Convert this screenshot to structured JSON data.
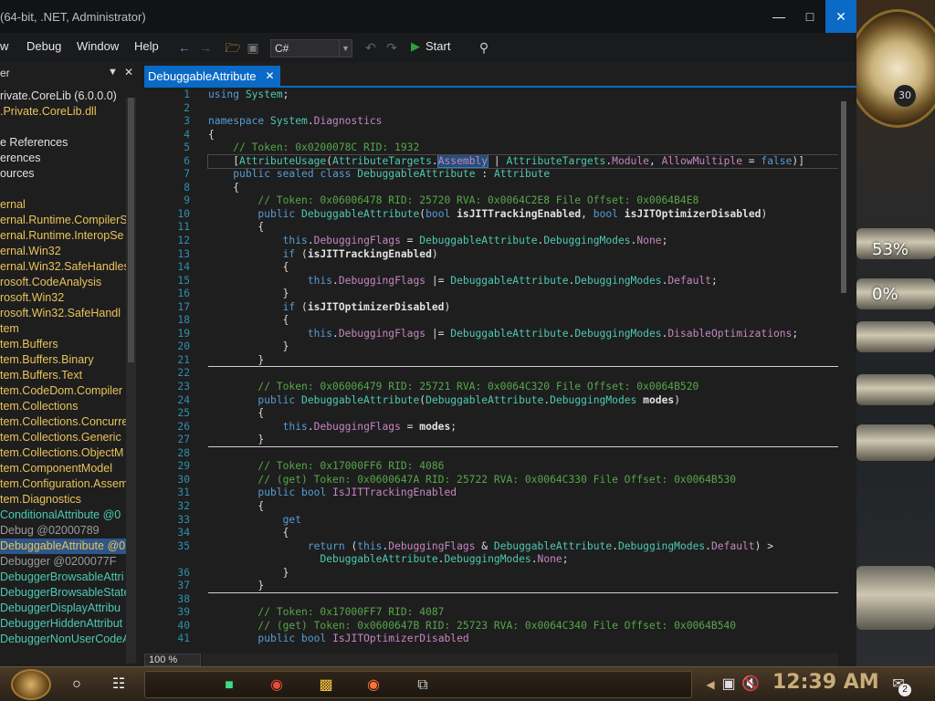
{
  "window": {
    "title": "(64-bit, .NET, Administrator)",
    "minimize_icon": "minimize-icon",
    "maximize_icon": "maximize-icon",
    "close_icon": "close-icon"
  },
  "menu": [
    "w",
    "Debug",
    "Window",
    "Help"
  ],
  "toolbar": {
    "language": "C#",
    "start_label": "Start"
  },
  "tree": {
    "header": "er",
    "items": [
      {
        "text": "rivate.CoreLib (6.0.0.0)",
        "style": "w"
      },
      {
        "text": ".Private.CoreLib.dll",
        "style": "p"
      },
      {
        "text": "",
        "style": "w"
      },
      {
        "text": "e References",
        "style": "w"
      },
      {
        "text": "erences",
        "style": "w"
      },
      {
        "text": "ources",
        "style": "w"
      },
      {
        "text": "",
        "style": "w"
      },
      {
        "text": "ernal",
        "style": "p"
      },
      {
        "text": "ernal.Runtime.CompilerSe",
        "style": "p"
      },
      {
        "text": "ernal.Runtime.InteropSe",
        "style": "p"
      },
      {
        "text": "ernal.Win32",
        "style": "p"
      },
      {
        "text": "ernal.Win32.SafeHandles",
        "style": "p"
      },
      {
        "text": "rosoft.CodeAnalysis",
        "style": "p"
      },
      {
        "text": "rosoft.Win32",
        "style": "p"
      },
      {
        "text": "rosoft.Win32.SafeHandl",
        "style": "p"
      },
      {
        "text": "tem",
        "style": "p"
      },
      {
        "text": "tem.Buffers",
        "style": "p"
      },
      {
        "text": "tem.Buffers.Binary",
        "style": "p"
      },
      {
        "text": "tem.Buffers.Text",
        "style": "p"
      },
      {
        "text": "tem.CodeDom.Compiler",
        "style": "p"
      },
      {
        "text": "tem.Collections",
        "style": "p"
      },
      {
        "text": "tem.Collections.Concurre",
        "style": "p"
      },
      {
        "text": "tem.Collections.Generic",
        "style": "p"
      },
      {
        "text": "tem.Collections.ObjectM",
        "style": "p"
      },
      {
        "text": "tem.ComponentModel",
        "style": "p"
      },
      {
        "text": "tem.Configuration.Assem",
        "style": "p"
      },
      {
        "text": "tem.Diagnostics",
        "style": "p"
      },
      {
        "text": "ConditionalAttribute @0",
        "style": "c"
      },
      {
        "text": "Debug  @02000789",
        "style": "d"
      },
      {
        "text": "DebuggableAttribute @0",
        "style": "sel"
      },
      {
        "text": "Debugger  @0200077F",
        "style": "d"
      },
      {
        "text": "DebuggerBrowsableAttri",
        "style": "c"
      },
      {
        "text": "DebuggerBrowsableState",
        "style": "c"
      },
      {
        "text": "DebuggerDisplayAttribu",
        "style": "c"
      },
      {
        "text": "DebuggerHiddenAttribut",
        "style": "c"
      },
      {
        "text": "DebuggerNonUserCodeA",
        "style": "c"
      }
    ]
  },
  "tab": {
    "label": "DebuggableAttribute",
    "close_icon": "close-icon"
  },
  "zoom": "100 %",
  "line_numbers": [
    "1",
    "2",
    "3",
    "4",
    "5",
    "6",
    "7",
    "8",
    "9",
    "10",
    "11",
    "12",
    "13",
    "14",
    "15",
    "16",
    "17",
    "18",
    "19",
    "20",
    "21",
    "22",
    "23",
    "24",
    "25",
    "26",
    "27",
    "28",
    "29",
    "30",
    "31",
    "32",
    "33",
    "34",
    "35",
    "",
    "36",
    "37",
    "38",
    "39",
    "40",
    "41"
  ],
  "code": [
    "using System;",
    "",
    "namespace System.Diagnostics",
    "{",
    "    // Token: 0x0200078C RID: 1932",
    "    [AttributeUsage(AttributeTargets.Assembly | AttributeTargets.Module, AllowMultiple = false)]",
    "    public sealed class DebuggableAttribute : Attribute",
    "    {",
    "        // Token: 0x06006478 RID: 25720 RVA: 0x0064C2E8 File Offset: 0x0064B4E8",
    "        public DebuggableAttribute(bool isJITTrackingEnabled, bool isJITOptimizerDisabled)",
    "        {",
    "            this.DebuggingFlags = DebuggableAttribute.DebuggingModes.None;",
    "            if (isJITTrackingEnabled)",
    "            {",
    "                this.DebuggingFlags |= DebuggableAttribute.DebuggingModes.Default;",
    "            }",
    "            if (isJITOptimizerDisabled)",
    "            {",
    "                this.DebuggingFlags |= DebuggableAttribute.DebuggingModes.DisableOptimizations;",
    "            }",
    "        }",
    "",
    "        // Token: 0x06006479 RID: 25721 RVA: 0x0064C320 File Offset: 0x0064B520",
    "        public DebuggableAttribute(DebuggableAttribute.DebuggingModes modes)",
    "        {",
    "            this.DebuggingFlags = modes;",
    "        }",
    "",
    "        // Token: 0x17000FF6 RID: 4086",
    "        // (get) Token: 0x0600647A RID: 25722 RVA: 0x0064C330 File Offset: 0x0064B530",
    "        public bool IsJITTrackingEnabled",
    "        {",
    "            get",
    "            {",
    "                return (this.DebuggingFlags & DebuggableAttribute.DebuggingModes.Default) >",
    "                  DebuggableAttribute.DebuggingModes.None;",
    "            }",
    "        }",
    "",
    "        // Token: 0x17000FF7 RID: 4087",
    "        // (get) Token: 0x0600647B RID: 25723 RVA: 0x0064C340 File Offset: 0x0064B540",
    "        public bool IsJITOptimizerDisabled"
  ],
  "desktop": {
    "gauge1": "53%",
    "gauge2": "0%",
    "clock_number": "30"
  },
  "taskbar": {
    "time": "12:39 AM",
    "notifications_badge": "2",
    "icons": [
      "start-orb-icon",
      "search-circle-icon",
      "task-view-icon",
      "chat-app-icon",
      "chrome-icon",
      "file-explorer-icon",
      "firefox-icon",
      "multi-window-icon",
      "network-icon",
      "volume-muted-icon",
      "notification-icon"
    ]
  },
  "colors": {
    "accent": "#0a6ac6",
    "keyword": "#569cd6",
    "comment": "#57a64a",
    "type": "#4ec9b0",
    "property": "#c586c0",
    "linenum": "#2b91af"
  }
}
